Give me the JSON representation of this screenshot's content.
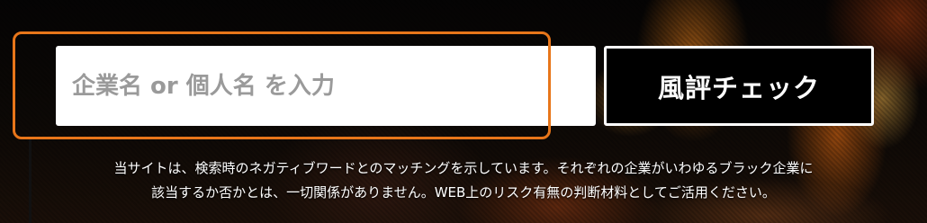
{
  "search": {
    "placeholder": "企業名 or 個人名 を入力",
    "value": ""
  },
  "check_button": {
    "label": "風評チェック"
  },
  "disclaimer": {
    "line1": "当サイトは、検索時のネガティブワードとのマッチングを示しています。それぞれの企業がいわゆるブラック企業に",
    "line2": "該当するか否かとは、一切関係がありません。WEB上のリスク有無の判断材料としてご活用ください。"
  },
  "colors": {
    "highlight_frame": "#e8761a",
    "button_bg": "#000000",
    "button_border": "#ffffff",
    "input_bg": "#ffffff",
    "placeholder": "#9a9a9a"
  }
}
